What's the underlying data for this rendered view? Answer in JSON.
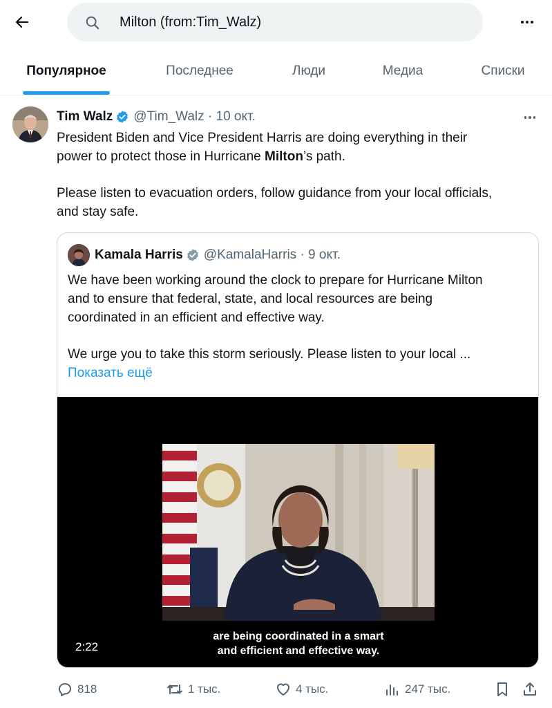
{
  "search": {
    "query": "Milton (from:Tim_Walz)"
  },
  "tabs": [
    {
      "label": "Популярное",
      "active": true
    },
    {
      "label": "Последнее",
      "active": false
    },
    {
      "label": "Люди",
      "active": false
    },
    {
      "label": "Медиа",
      "active": false
    },
    {
      "label": "Списки",
      "active": false
    }
  ],
  "tweet": {
    "author_name": "Tim Walz",
    "handle_date": "@Tim_Walz · 10 окт.",
    "text_line1": "President Biden and Vice President Harris are doing everything in their",
    "text_line2_pre": "power to protect those in Hurricane ",
    "text_line2_bold": "Milton",
    "text_line2_post": "’s path.",
    "text_line3": "Please listen to evacuation orders, follow guidance from your local officials,",
    "text_line4": "and stay safe.",
    "quote": {
      "author_name": "Kamala Harris",
      "handle_date": "@KamalaHarris · 9 окт.",
      "text_line1": "We have been working around the clock to prepare for Hurricane Milton",
      "text_line2": "and to ensure that federal, state, and local resources are being",
      "text_line3": "coordinated in an efficient and effective way.",
      "text_line4": "We urge you to take this storm seriously. Please listen to your local ...",
      "show_more": "Показать ещё",
      "video": {
        "subtitle_line1": "are being coordinated in a smart",
        "subtitle_line2": "and efficient and effective way.",
        "duration": "2:22"
      }
    },
    "stats": {
      "replies": "818",
      "reposts": "1 тыс.",
      "likes": "4 тыс.",
      "views": "247 тыс."
    }
  },
  "colors": {
    "accent": "#1d9bf0",
    "secondary_text": "#536471",
    "border": "#cfd9de",
    "search_bg": "#eff3f4"
  },
  "icons": [
    "back-arrow-icon",
    "search-icon",
    "more-icon",
    "verified-badge-icon",
    "reply-icon",
    "repost-icon",
    "like-icon",
    "views-icon",
    "bookmark-icon",
    "share-icon"
  ]
}
